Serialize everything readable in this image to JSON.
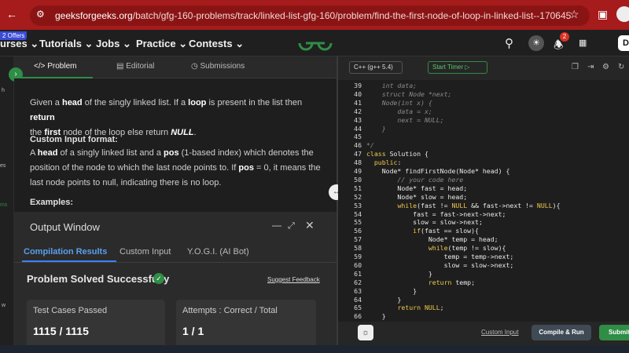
{
  "browser": {
    "url_domain": "geeksforgeeks.org",
    "url_path": "/batch/gfg-160-problems/track/linked-list-gfg-160/problem/find-the-first-node-of-loop-in-linked-list--170645",
    "notification_count": "2",
    "profile_initial": "D"
  },
  "nav": {
    "offers_badge": "2 Offers",
    "items": [
      "urses",
      "Tutorials",
      "Jobs",
      "Practice",
      "Contests"
    ]
  },
  "left_strip": {
    "labels": [
      "h",
      "es",
      "ms",
      "w"
    ]
  },
  "tabs": {
    "problem": "Problem",
    "editorial": "Editorial",
    "submissions": "Submissions"
  },
  "problem": {
    "para1_a": "Given a ",
    "para1_b": "head",
    "para1_c": " of the singly linked list. If a ",
    "para1_d": "loop",
    "para1_e": " is present in the list then ",
    "para1_f": "return",
    "para1_g": "the ",
    "para1_h": "first",
    "para1_i": " node of the loop else return ",
    "para1_j": "NULL",
    "para1_k": ".",
    "custom_input_heading": "Custom Input format:",
    "para2_a": "A ",
    "para2_b": "head",
    "para2_c": " of a singly linked list and a ",
    "para2_d": "pos",
    "para2_e": " (1-based index) which denotes the",
    "para2_line2": "position of the node to which the last node points to. If ",
    "para2_f": "pos",
    "para2_g": " = 0, it means the",
    "para2_line3": "last node points to null, indicating there is no loop.",
    "examples_heading": "Examples:"
  },
  "output": {
    "title": "Output Window",
    "tab_compilation": "Compilation Results",
    "tab_custom": "Custom Input",
    "tab_yogi": "Y.O.G.I. (AI Bot)",
    "status": "Problem Solved Successfully",
    "feedback": "Suggest Feedback",
    "cards": [
      {
        "label": "Test Cases Passed",
        "value": "1115 / 1115"
      },
      {
        "label": "Attempts : Correct / Total",
        "value": "1 / 1"
      }
    ]
  },
  "editor": {
    "language": "C++ (g++ 5.4)",
    "timer": "Start Timer",
    "line_numbers": [
      "39",
      "40",
      "41",
      "42",
      "43",
      "44",
      "45",
      "46",
      "47",
      "48",
      "49",
      "50",
      "51",
      "52",
      "53",
      "54",
      "55",
      "56",
      "57",
      "58",
      "59",
      "60",
      "61",
      "62",
      "63",
      "64",
      "65",
      "66"
    ],
    "lines": [
      "    int data;",
      "    struct Node *next;",
      "    Node(int x) {",
      "        data = x;",
      "        next = NULL;",
      "    }",
      "",
      "*/",
      "class Solution {",
      "  public:",
      "    Node* findFirstNode(Node* head) {",
      "        // your code here",
      "        Node* fast = head;",
      "        Node* slow = head;",
      "        while(fast != NULL && fast->next != NULL){",
      "            fast = fast->next->next;",
      "            slow = slow->next;",
      "            if(fast == slow){",
      "                Node* temp = head;",
      "                while(temp != slow){",
      "                    temp = temp->next;",
      "                    slow = slow->next;",
      "                }",
      "                return temp;",
      "            }",
      "        }",
      "        return NULL;",
      "    }"
    ],
    "comment_lines": [
      0,
      1,
      2,
      3,
      4,
      5,
      7,
      11
    ]
  },
  "footer": {
    "custom_input": "Custom Input",
    "compile": "Compile & Run",
    "submit": "Submit"
  }
}
